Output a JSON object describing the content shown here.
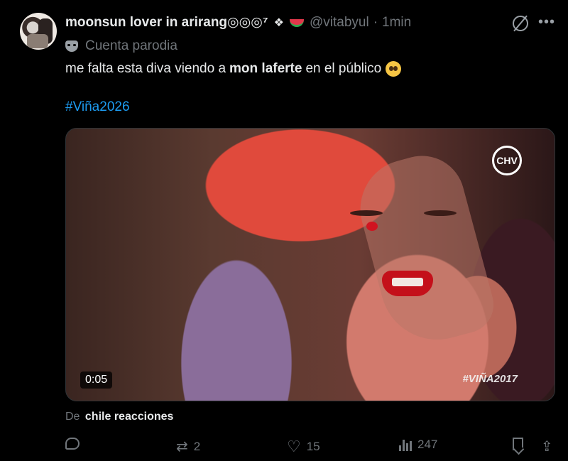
{
  "author": {
    "display_name": "moonsun lover in arirang◎◎◎⁷",
    "name_emoji": "❖",
    "handle": "@vitabyul",
    "separator": "·",
    "time": "1min",
    "badge": "Cuenta parodia"
  },
  "tweet": {
    "text_before": "me falta esta diva viendo a",
    "text_bold": "mon laferte",
    "text_after": "en el público",
    "hashtag": "#Viña2026"
  },
  "media": {
    "logo": "CHV",
    "duration": "0:05",
    "overlay_tag": "#VIÑA2017"
  },
  "source": {
    "prefix": "De",
    "name": "chile reacciones"
  },
  "actions": {
    "reposts": "2",
    "likes": "15",
    "views": "247"
  },
  "colors": {
    "background": "#000000",
    "text": "#e7e9ea",
    "muted": "#71767b",
    "link": "#1d9bf0"
  },
  "icons": [
    "grok-icon",
    "more-icon",
    "parody-mask-icon",
    "reply-icon",
    "retweet-icon",
    "like-icon",
    "views-icon",
    "bookmark-icon",
    "share-icon"
  ]
}
